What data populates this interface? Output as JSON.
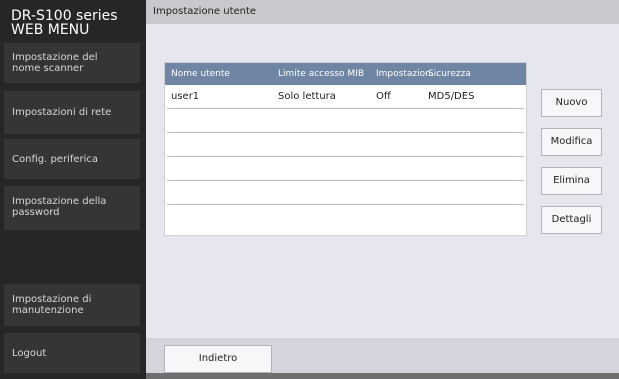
{
  "sidebar": {
    "brand_line1": "DR-S100 series",
    "brand_line2": "WEB MENU",
    "items": [
      {
        "label": "Impostazione del\nnome scanner"
      },
      {
        "label": "Impostazioni di rete"
      },
      {
        "label": "Config. periferica"
      },
      {
        "label": "Impostazione della\npassword"
      },
      {
        "label": "Impostazione di\nmanutenzione"
      },
      {
        "label": "Logout"
      }
    ]
  },
  "main": {
    "title": "Impostazione utente",
    "table": {
      "columns": [
        "Nome utente",
        "Limite accesso MIB",
        "Impostazion...",
        "Sicurezza"
      ],
      "rows": [
        [
          "user1",
          "Solo lettura",
          "Off",
          "MD5/DES"
        ],
        [
          "",
          "",
          "",
          ""
        ],
        [
          "",
          "",
          "",
          ""
        ],
        [
          "",
          "",
          "",
          ""
        ],
        [
          "",
          "",
          "",
          ""
        ]
      ]
    },
    "buttons": {
      "new": "Nuovo",
      "edit": "Modifica",
      "delete": "Elimina",
      "details": "Dettagli"
    },
    "back": "Indietro"
  }
}
